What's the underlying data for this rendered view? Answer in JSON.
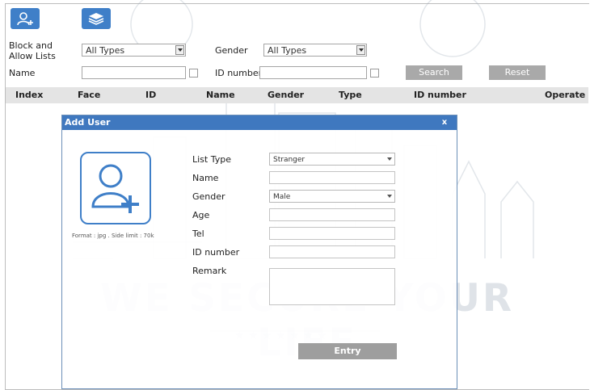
{
  "toolbar": {
    "add_user_icon": "add-user-icon",
    "layers_icon": "layers-icon"
  },
  "filters": {
    "block_allow_label": "Block and Allow Lists",
    "block_allow_value": "All Types",
    "gender_label": "Gender",
    "gender_value": "All Types",
    "name_label": "Name",
    "id_number_label": "ID number",
    "search_label": "Search",
    "reset_label": "Reset"
  },
  "table": {
    "headers": [
      "Index",
      "Face",
      "ID",
      "Name",
      "Gender",
      "Type",
      "ID number",
      "Operate"
    ]
  },
  "dialog": {
    "title": "Add User",
    "close_glyph": "x",
    "photo_hint": "Format : jpg . Side limit : 70k",
    "fields": {
      "list_type_label": "List Type",
      "list_type_value": "Stranger",
      "name_label": "Name",
      "gender_label": "Gender",
      "gender_value": "Male",
      "age_label": "Age",
      "tel_label": "Tel",
      "id_number_label": "ID number",
      "remark_label": "Remark"
    },
    "entry_label": "Entry"
  },
  "watermark": {
    "text": "WE SECURE YOUR LIFE"
  },
  "colors": {
    "accent": "#3f7fc8",
    "dialog_title": "#3f78bf",
    "button_gray": "#a9a9a9"
  }
}
